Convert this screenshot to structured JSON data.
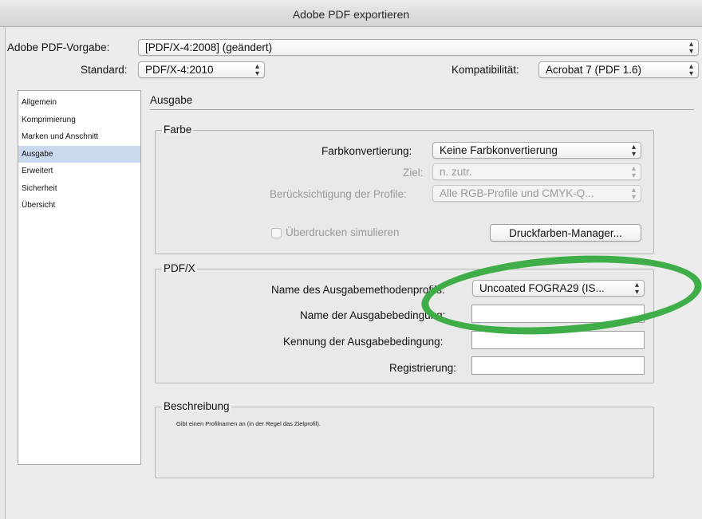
{
  "window": {
    "title": "Adobe PDF exportieren"
  },
  "header": {
    "preset_label": "Adobe PDF-Vorgabe:",
    "preset_value": "[PDF/X-4:2008] (geändert)",
    "standard_label": "Standard:",
    "standard_value": "PDF/X-4:2010",
    "compat_label": "Kompatibilität:",
    "compat_value": "Acrobat 7 (PDF 1.6)"
  },
  "sidebar": {
    "items": [
      {
        "label": "Allgemein"
      },
      {
        "label": "Komprimierung"
      },
      {
        "label": "Marken und Anschnitt"
      },
      {
        "label": "Ausgabe"
      },
      {
        "label": "Erweitert"
      },
      {
        "label": "Sicherheit"
      },
      {
        "label": "Übersicht"
      }
    ],
    "selected": "Ausgabe"
  },
  "section": {
    "title": "Ausgabe"
  },
  "farbe": {
    "legend": "Farbe",
    "conversion_label": "Farbkonvertierung:",
    "conversion_value": "Keine Farbkonvertierung",
    "target_label": "Ziel:",
    "target_value": "n. zutr.",
    "profiles_label": "Berücksichtigung der Profile:",
    "profiles_value": "Alle RGB-Profile und CMYK-Q...",
    "simulate_label": "Überdrucken simulieren",
    "ink_manager_label": "Druckfarben-Manager..."
  },
  "pdfx": {
    "legend": "PDF/X",
    "profile_name_label": "Name des Ausgabemethodenprofils:",
    "profile_name_value": "Uncoated FOGRA29 (IS...",
    "condition_name_label": "Name der Ausgabebedingung:",
    "condition_name_value": "",
    "condition_id_label": "Kennung der Ausgabebedingung:",
    "condition_id_value": "",
    "registry_label": "Registrierung:",
    "registry_value": ""
  },
  "description": {
    "legend": "Beschreibung",
    "text": "Gibt einen Profilnamen an (in der Regel das Zielprofil)."
  },
  "colors": {
    "annotation": "#3fae49",
    "selection": "#c9d9ee"
  },
  "icons": {
    "select_arrow": "updown-chevron-icon"
  }
}
